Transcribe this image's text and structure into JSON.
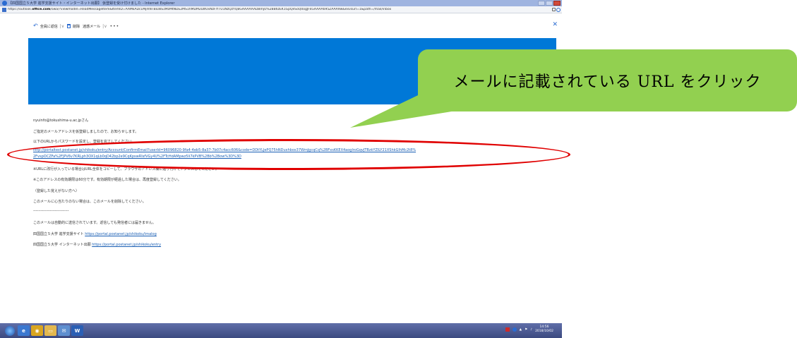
{
  "window": {
    "title": "【四国国立５大学 進学支援サイト・インターネット出願】 仮登録を受け付けました - Internet Explorer",
    "url_prefix": "https://outlook.",
    "url_domain": "office.com",
    "url_rest": "/owa/?viewmodel=ReadMessageItem&ItemID=AAMkADc1MjlhNTBiLWEzMzMtNDE2MS1hMDM2LWUxNzFlYTU1NzQzYQBGAAAAAADBmjU%2BB6zEK1GpQeSoQ0ogJFkGAAAA695ZAAA9w&exvsurl=1&path=/mail/inbox"
  },
  "toolbar": {
    "reply_all": "全員に返信",
    "delete": "削除",
    "junk": "迷惑メール",
    "more": "•••"
  },
  "mail": {
    "greeting": "nyuinfo@tokushima-u.ac.jpさん",
    "line1": "ご指定のメールアドレスを仮登録しましたので、お知らせします。",
    "line2": "以下のURLからパスワードを設定し、登録を完了してください。",
    "link_line1": "http://portaltest.postanet.jp/shikoku/entry/Account/ConfirmEmail?userId=96096820-9fa4-4eb5-8a37-7b07c4acc606&code=DDtYLJePQ75hNDuxhbos37WmJgcqCq%2BFxsKKEX4aoglroGqvJTBzkYZILY21XShkGlhMc2t8%",
    "link_line2": "2FvspOCZFa%2FJPV6v7KRLph3OX1qLb0qD42bp2e9CqKpswRIsfVGy4U%2FTcHdAMpwz5li7kPVB%2Bb%2Bow%3D%3D",
    "note1": "※URLに改行が入っている場合はURL全体をコピーして、ブラウザのアドレス欄に貼り付けてアクセスしてください。",
    "note2": "※このアドレスの有効期限は60分です。有効期限が経過した場合は、再度登録してください。",
    "note3": "（登録した覚えがない方へ）",
    "note4": "このメールに心当たりのない場合は、このメールを削除してください。",
    "divider": "----------------------------",
    "auto1": "このメールは自動的に送信されています。返信しても発信者には届きません。",
    "site1_label": "四国国立５大学 進学支援サイト",
    "site1_url": "https://portal.postanet.jp/shikoku/imalog",
    "site2_label": "四国国立５大学 インターネット出願",
    "site2_url": "https://portal.postanet.jp/shikoku/entry"
  },
  "taskbar": {
    "word_label": "W",
    "time": "14:56",
    "date": "2018/10/02"
  },
  "callout": {
    "text": "メールに記載されている URL をクリック"
  },
  "colors": {
    "banner": "#0078d7",
    "callout": "#92d050",
    "annotation": "#e00000",
    "link": "#1a5fb4"
  }
}
